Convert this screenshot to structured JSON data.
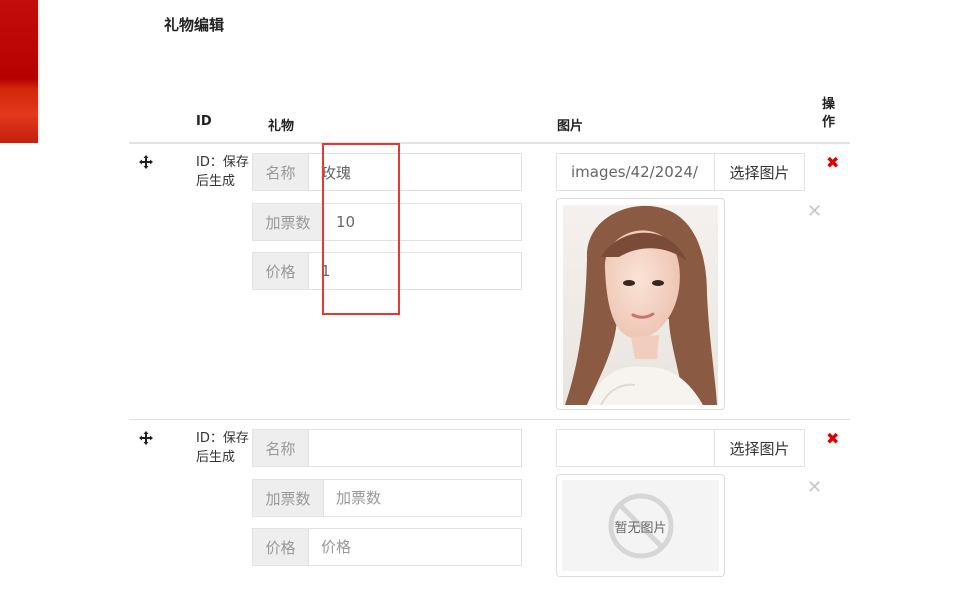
{
  "section": {
    "title": "礼物编辑"
  },
  "table": {
    "headers": {
      "id": "ID",
      "gift": "礼物",
      "image": "图片",
      "action": "操作"
    }
  },
  "rows": [
    {
      "id_text": "ID：保存后生成",
      "fields": [
        {
          "label": "名称",
          "value": "玫瑰",
          "placeholder": "名称"
        },
        {
          "label": "加票数",
          "value": "10",
          "placeholder": "加票数"
        },
        {
          "label": "价格",
          "value": "1",
          "placeholder": "价格"
        }
      ],
      "image_path": "images/42/2024/",
      "pick_label": "选择图片",
      "has_image": true,
      "thumb_alt": "portrait-photo",
      "remove_glyph": "✕",
      "delete_glyph": "✖"
    },
    {
      "id_text": "ID：保存后生成",
      "fields": [
        {
          "label": "名称",
          "value": "",
          "placeholder": ""
        },
        {
          "label": "加票数",
          "value": "",
          "placeholder": "加票数"
        },
        {
          "label": "价格",
          "value": "",
          "placeholder": "价格"
        }
      ],
      "image_path": "",
      "pick_label": "选择图片",
      "has_image": false,
      "no_image_text": "暂无图片",
      "remove_glyph": "✕",
      "delete_glyph": "✖"
    }
  ],
  "colors": {
    "accent_red": "#e00000",
    "annotation": "#e53935",
    "addon_bg": "#eeeeee"
  },
  "icons": {
    "move": "move-arrows-icon",
    "delete": "delete-x-icon",
    "remove": "remove-image-icon",
    "no_image": "no-image-icon"
  }
}
